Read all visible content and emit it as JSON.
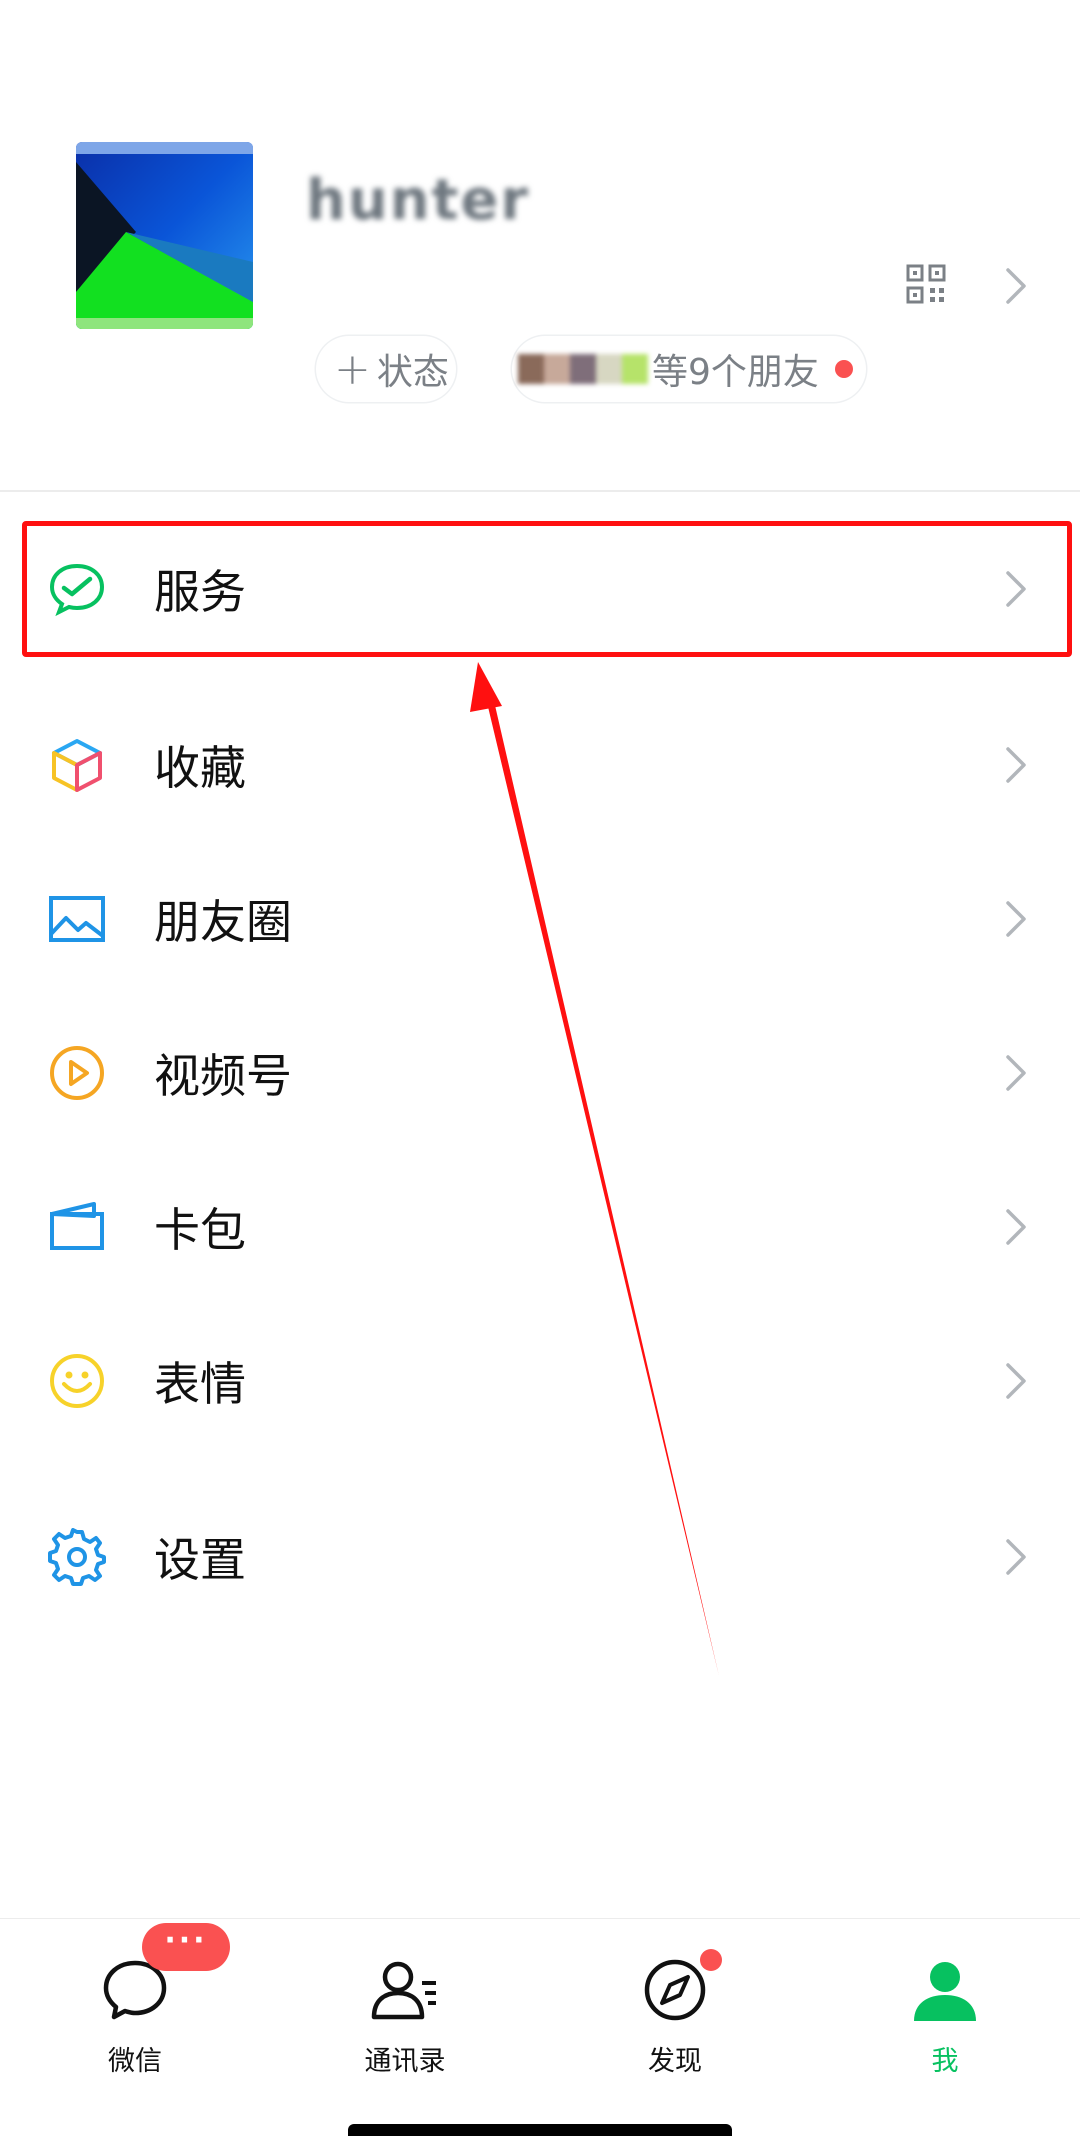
{
  "profile": {
    "username": "hunter",
    "status_plus": "+",
    "status_label": "状态",
    "friends_label": "等9个朋友"
  },
  "menu": [
    {
      "label": "服务",
      "icon": "wechat-pay-icon"
    },
    {
      "label": "收藏",
      "icon": "favorites-cube-icon"
    },
    {
      "label": "朋友圈",
      "icon": "moments-photo-icon"
    },
    {
      "label": "视频号",
      "icon": "channels-play-icon"
    },
    {
      "label": "卡包",
      "icon": "card-wallet-icon"
    },
    {
      "label": "表情",
      "icon": "sticker-smile-icon"
    },
    {
      "label": "设置",
      "icon": "settings-gear-icon"
    }
  ],
  "tabbar": {
    "chats": {
      "label": "微信",
      "badge": "···"
    },
    "contacts": {
      "label": "通讯录"
    },
    "discover": {
      "label": "发现"
    },
    "me": {
      "label": "我"
    }
  },
  "colors": {
    "brand_green": "#07c160",
    "badge_red": "#fa5151",
    "highlight_red": "#ff1010"
  }
}
